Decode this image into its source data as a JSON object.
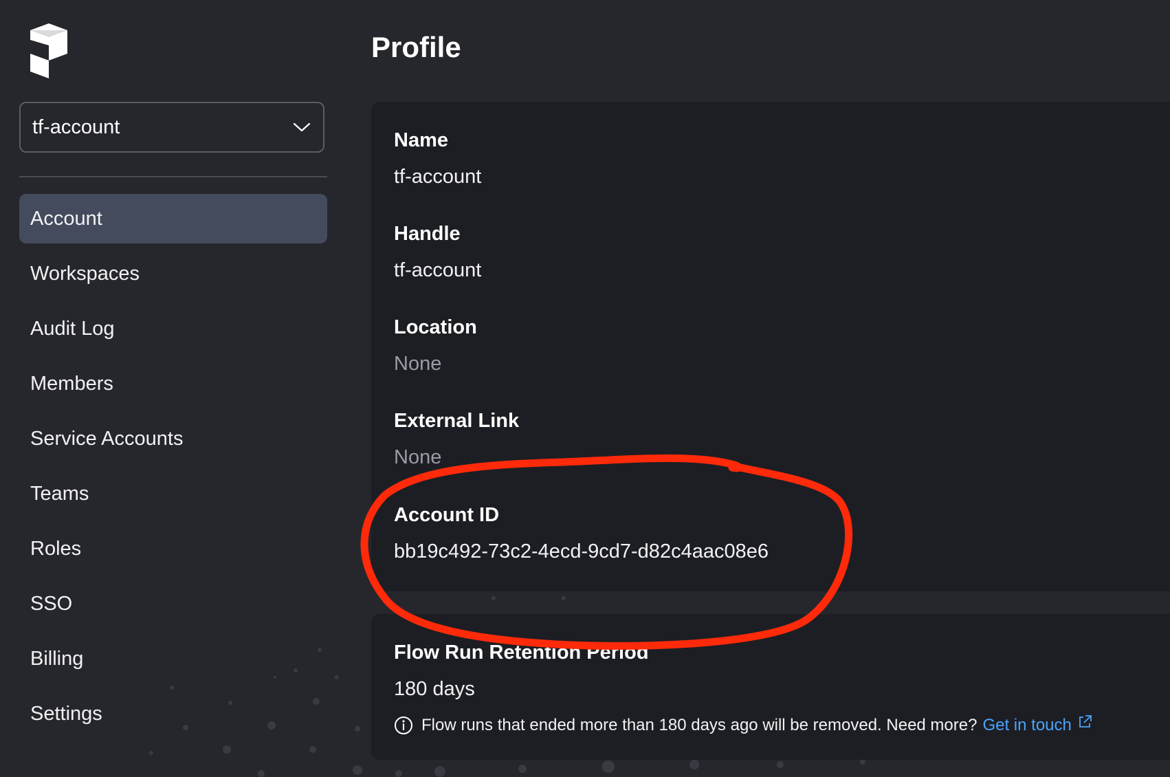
{
  "sidebar": {
    "logo_icon": "prefect-logo-icon",
    "account_select": {
      "value": "tf-account",
      "icon": "chevron-down-icon"
    },
    "items": [
      {
        "label": "Account",
        "active": true
      },
      {
        "label": "Workspaces",
        "active": false
      },
      {
        "label": "Audit Log",
        "active": false
      },
      {
        "label": "Members",
        "active": false
      },
      {
        "label": "Service Accounts",
        "active": false
      },
      {
        "label": "Teams",
        "active": false
      },
      {
        "label": "Roles",
        "active": false
      },
      {
        "label": "SSO",
        "active": false
      },
      {
        "label": "Billing",
        "active": false
      },
      {
        "label": "Settings",
        "active": false
      }
    ]
  },
  "main": {
    "title": "Profile",
    "profile": {
      "name_label": "Name",
      "name_value": "tf-account",
      "handle_label": "Handle",
      "handle_value": "tf-account",
      "location_label": "Location",
      "location_value": "None",
      "external_link_label": "External Link",
      "external_link_value": "None",
      "account_id_label": "Account ID",
      "account_id_value": "bb19c492-73c2-4ecd-9cd7-d82c4aac08e6"
    },
    "retention": {
      "label": "Flow Run Retention Period",
      "value": "180 days",
      "info_text": "Flow runs that ended more than 180 days ago will be removed. Need more?",
      "link_text": "Get in touch",
      "info_icon": "info-circle-icon",
      "link_icon": "external-link-icon"
    }
  },
  "colors": {
    "background": "#26272c",
    "card": "#1d1e23",
    "active_nav": "#444b5c",
    "link": "#4aa3ff",
    "annotation": "#ff2a0a"
  }
}
